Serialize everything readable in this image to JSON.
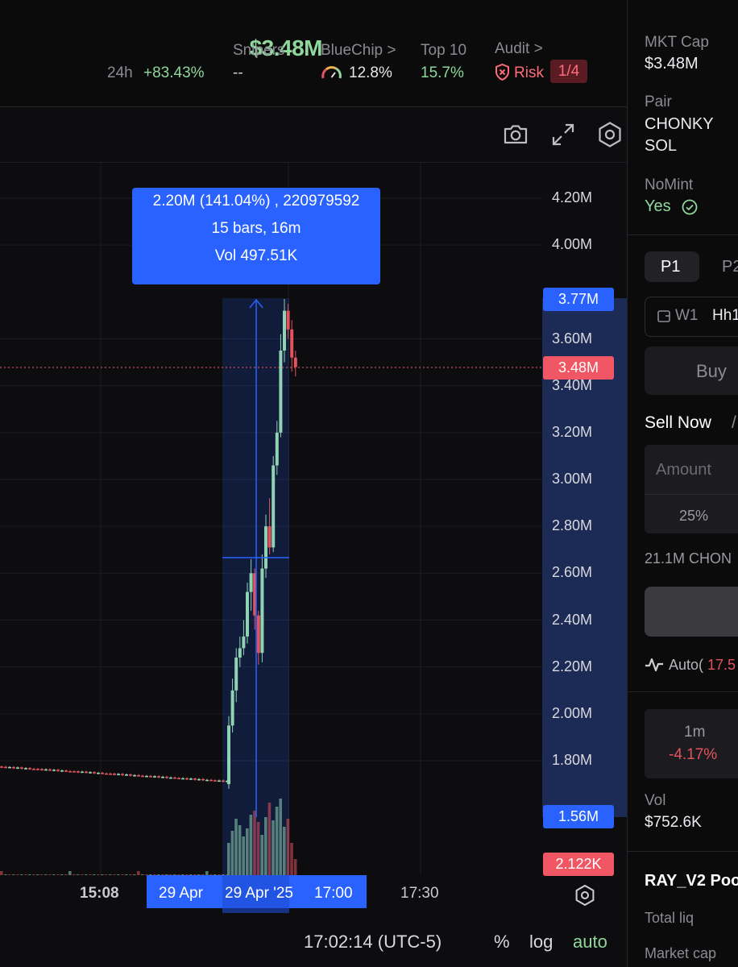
{
  "header": {
    "market_cap": "$3.48M",
    "period": "24h",
    "change": "+83.43%",
    "snipers_label": "Snipers",
    "snipers_value": "--",
    "bluechip_label": "BlueChip >",
    "bluechip_value": "12.8%",
    "top10_label": "Top 10",
    "top10_value": "15.7%",
    "audit_label": "Audit >",
    "risk_label": "Risk",
    "risk_value": "1/4"
  },
  "toolbar": {
    "icons": [
      "camera-icon",
      "expand-icon",
      "gear-icon"
    ]
  },
  "chart": {
    "price_labels": [
      "4.20M",
      "4.00M",
      "3.60M",
      "3.40M",
      "3.20M",
      "3.00M",
      "2.80M",
      "2.60M",
      "2.40M",
      "2.20M",
      "2.00M",
      "1.80M"
    ],
    "high_tag": "3.77M",
    "current_tag": "3.48M",
    "low_tag": "1.56M",
    "volume_tag": "2.122K",
    "tooltip_line1": "2.20M (141.04%) , 220979592",
    "tooltip_line2": "15 bars, 16m",
    "tooltip_line3": "Vol 497.51K",
    "colors": {
      "up": "#8fd3b3",
      "down": "#e2535e",
      "selection": "#2962ff",
      "current": "#ff5a67"
    }
  },
  "time_axis": {
    "label_1508": "15:08",
    "sel_start": "29 Apr",
    "sel_mid": "29 Apr '25",
    "sel_end": "17:00",
    "label_1730": "17:30"
  },
  "footer": {
    "time": "17:02:14 (UTC-5)",
    "pct": "%",
    "log": "log",
    "auto": "auto"
  },
  "right_panel": {
    "mkt_cap_label": "MKT Cap",
    "mkt_cap_value": "$3.48M",
    "pair_label": "Pair",
    "pair_line1": "CHONKY",
    "pair_line2": "SOL",
    "nomint_label": "NoMint",
    "nomint_value": "Yes",
    "preset1": "P1",
    "preset2": "P2",
    "wallet_label": "W1",
    "wallet_value": "Hh1",
    "buy_label": "Buy",
    "sell_now_label": "Sell Now",
    "amount_placeholder": "Amount",
    "pct_25": "25%",
    "balance": "21.1M CHON",
    "auto_label": "Auto(",
    "auto_value": "17.5",
    "tf_label": "1m",
    "tf_change": "-4.17%",
    "vol_label": "Vol",
    "vol_value": "$752.6K",
    "pool_label": "RAY_V2 Poo",
    "total_liq_label": "Total liq",
    "market_cap_label": "Market cap"
  }
}
